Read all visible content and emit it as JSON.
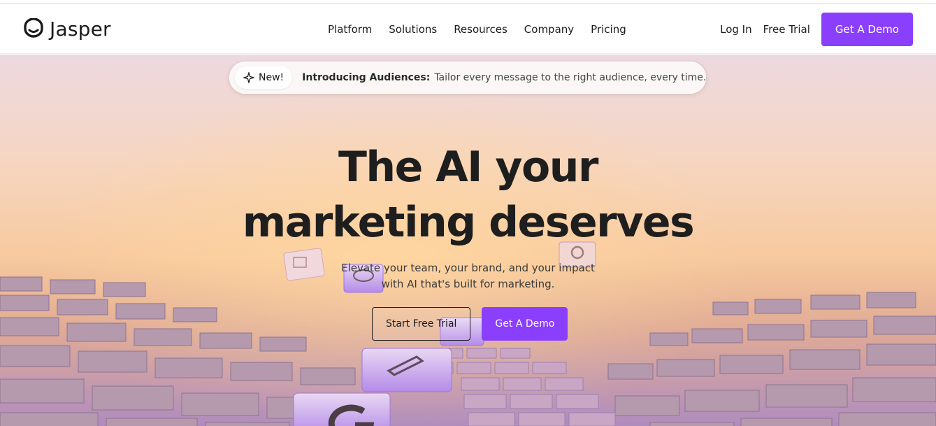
{
  "brand": {
    "name": "Jasper",
    "accent": "#8a3ffc"
  },
  "nav": {
    "items": [
      {
        "label": "Platform"
      },
      {
        "label": "Solutions"
      },
      {
        "label": "Resources"
      },
      {
        "label": "Company"
      },
      {
        "label": "Pricing"
      }
    ]
  },
  "header_actions": {
    "login": "Log In",
    "free_trial": "Free Trial",
    "demo": "Get A Demo"
  },
  "announcement": {
    "badge": "New!",
    "title": "Introducing Audiences:",
    "text": "Tailor every message to the right audience, every time.",
    "icons": [
      "sparkle-icon",
      "arrow-right-icon"
    ]
  },
  "hero": {
    "headline_line1": "The AI your",
    "headline_line2": "marketing deserves",
    "sub_line1": "Elevate your team, your brand, and your impact",
    "sub_line2": "with AI that's built for marketing.",
    "cta_trial": "Start Free Trial",
    "cta_demo": "Get A Demo"
  }
}
